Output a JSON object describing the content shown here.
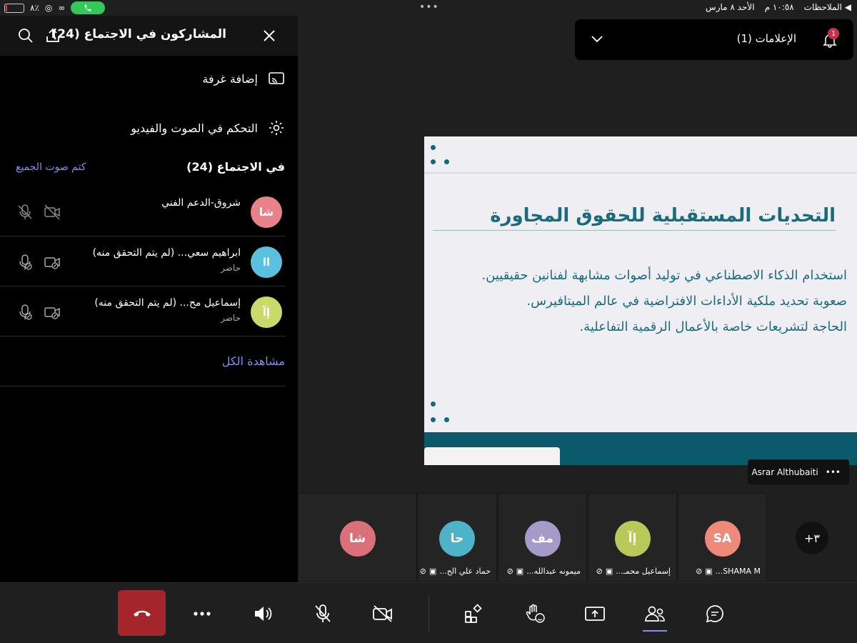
{
  "status_bar": {
    "back_label": "◀ الملاحظات",
    "time": "١٠:٥٨ م",
    "date": "الأحد ٨ مارس",
    "battery": "٨٪",
    "battery_level": 0.08
  },
  "panel": {
    "title": "المشاركون في الاجتماع (24)",
    "add_room": "إضافة غرفة",
    "av_control": "التحكم في الصوت والفيديو",
    "in_meeting": "في الاجتماع (24)",
    "mute_all": "كتم صوت الجميع",
    "view_all": "مشاهدة الكل",
    "participants": [
      {
        "initials": "شا",
        "name": "شروق-الدعم الفني",
        "status": "",
        "color": "#e8828a"
      },
      {
        "initials": "اا",
        "name": "ابراهيم سعي...  (لم يتم التحقق منه)",
        "status": "حاضر",
        "color": "#5bc0de"
      },
      {
        "initials": "إآ",
        "name": "إسماعيل مح...  (لم يتم التحقق منه)",
        "status": "حاضر",
        "color": "#c9da6b"
      }
    ]
  },
  "notifications": {
    "label": "الإعلامات (1)",
    "badge": "1"
  },
  "slide": {
    "title": "التحديات المستقبلية للحقوق المجاورة",
    "lines": [
      "استخدام الذكاء الاصطناعي في توليد أصوات مشابهة لفنانين حقيقيين.",
      "صعوبة تحديد ملكية الأداءات الافتراضية في عالم الميتافيرس.",
      "الحاجة لتشريعات خاصة بالأعمال الرقمية التفاعلية."
    ]
  },
  "presenter": {
    "name": "Asrar Althubaiti",
    "more": "•••"
  },
  "tiles": [
    {
      "initials": "شا",
      "name": "",
      "color": "#d9707a"
    },
    {
      "initials": "حا",
      "name": "حماد علي الح...",
      "color": "#4fb3c8"
    },
    {
      "initials": "مف",
      "name": "ميمونه عبدالله...",
      "color": "#a59bc9"
    },
    {
      "initials": "إآ",
      "name": "إسماعيل محمـ...",
      "color": "#b8c95a"
    },
    {
      "initials": "SA",
      "name": "SHAMA M...",
      "color": "#ee8a7a"
    }
  ],
  "more_count": "+٣"
}
